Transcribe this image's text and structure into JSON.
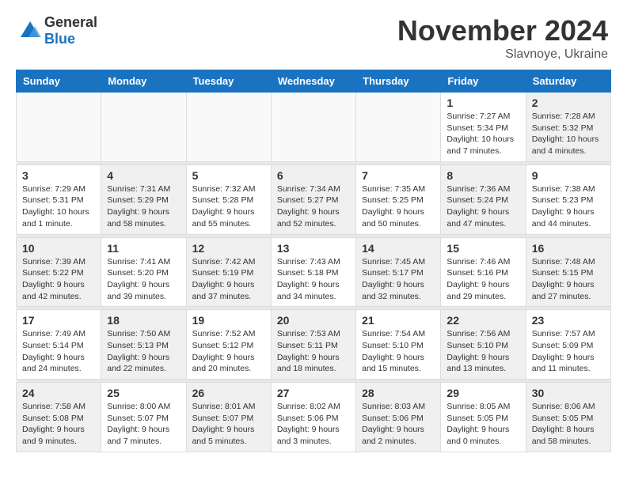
{
  "header": {
    "logo": {
      "general": "General",
      "blue": "Blue"
    },
    "title": "November 2024",
    "location": "Slavnoye, Ukraine"
  },
  "calendar": {
    "days_of_week": [
      "Sunday",
      "Monday",
      "Tuesday",
      "Wednesday",
      "Thursday",
      "Friday",
      "Saturday"
    ],
    "weeks": [
      {
        "days": [
          {
            "num": "",
            "empty": true
          },
          {
            "num": "",
            "empty": true
          },
          {
            "num": "",
            "empty": true
          },
          {
            "num": "",
            "empty": true
          },
          {
            "num": "",
            "empty": true
          },
          {
            "num": "1",
            "sunrise": "Sunrise: 7:27 AM",
            "sunset": "Sunset: 5:34 PM",
            "daylight": "Daylight: 10 hours and 7 minutes."
          },
          {
            "num": "2",
            "sunrise": "Sunrise: 7:28 AM",
            "sunset": "Sunset: 5:32 PM",
            "daylight": "Daylight: 10 hours and 4 minutes.",
            "shaded": true
          }
        ]
      },
      {
        "days": [
          {
            "num": "3",
            "sunrise": "Sunrise: 7:29 AM",
            "sunset": "Sunset: 5:31 PM",
            "daylight": "Daylight: 10 hours and 1 minute."
          },
          {
            "num": "4",
            "sunrise": "Sunrise: 7:31 AM",
            "sunset": "Sunset: 5:29 PM",
            "daylight": "Daylight: 9 hours and 58 minutes.",
            "shaded": true
          },
          {
            "num": "5",
            "sunrise": "Sunrise: 7:32 AM",
            "sunset": "Sunset: 5:28 PM",
            "daylight": "Daylight: 9 hours and 55 minutes."
          },
          {
            "num": "6",
            "sunrise": "Sunrise: 7:34 AM",
            "sunset": "Sunset: 5:27 PM",
            "daylight": "Daylight: 9 hours and 52 minutes.",
            "shaded": true
          },
          {
            "num": "7",
            "sunrise": "Sunrise: 7:35 AM",
            "sunset": "Sunset: 5:25 PM",
            "daylight": "Daylight: 9 hours and 50 minutes."
          },
          {
            "num": "8",
            "sunrise": "Sunrise: 7:36 AM",
            "sunset": "Sunset: 5:24 PM",
            "daylight": "Daylight: 9 hours and 47 minutes.",
            "shaded": true
          },
          {
            "num": "9",
            "sunrise": "Sunrise: 7:38 AM",
            "sunset": "Sunset: 5:23 PM",
            "daylight": "Daylight: 9 hours and 44 minutes."
          }
        ]
      },
      {
        "days": [
          {
            "num": "10",
            "sunrise": "Sunrise: 7:39 AM",
            "sunset": "Sunset: 5:22 PM",
            "daylight": "Daylight: 9 hours and 42 minutes.",
            "shaded": true
          },
          {
            "num": "11",
            "sunrise": "Sunrise: 7:41 AM",
            "sunset": "Sunset: 5:20 PM",
            "daylight": "Daylight: 9 hours and 39 minutes."
          },
          {
            "num": "12",
            "sunrise": "Sunrise: 7:42 AM",
            "sunset": "Sunset: 5:19 PM",
            "daylight": "Daylight: 9 hours and 37 minutes.",
            "shaded": true
          },
          {
            "num": "13",
            "sunrise": "Sunrise: 7:43 AM",
            "sunset": "Sunset: 5:18 PM",
            "daylight": "Daylight: 9 hours and 34 minutes."
          },
          {
            "num": "14",
            "sunrise": "Sunrise: 7:45 AM",
            "sunset": "Sunset: 5:17 PM",
            "daylight": "Daylight: 9 hours and 32 minutes.",
            "shaded": true
          },
          {
            "num": "15",
            "sunrise": "Sunrise: 7:46 AM",
            "sunset": "Sunset: 5:16 PM",
            "daylight": "Daylight: 9 hours and 29 minutes."
          },
          {
            "num": "16",
            "sunrise": "Sunrise: 7:48 AM",
            "sunset": "Sunset: 5:15 PM",
            "daylight": "Daylight: 9 hours and 27 minutes.",
            "shaded": true
          }
        ]
      },
      {
        "days": [
          {
            "num": "17",
            "sunrise": "Sunrise: 7:49 AM",
            "sunset": "Sunset: 5:14 PM",
            "daylight": "Daylight: 9 hours and 24 minutes."
          },
          {
            "num": "18",
            "sunrise": "Sunrise: 7:50 AM",
            "sunset": "Sunset: 5:13 PM",
            "daylight": "Daylight: 9 hours and 22 minutes.",
            "shaded": true
          },
          {
            "num": "19",
            "sunrise": "Sunrise: 7:52 AM",
            "sunset": "Sunset: 5:12 PM",
            "daylight": "Daylight: 9 hours and 20 minutes."
          },
          {
            "num": "20",
            "sunrise": "Sunrise: 7:53 AM",
            "sunset": "Sunset: 5:11 PM",
            "daylight": "Daylight: 9 hours and 18 minutes.",
            "shaded": true
          },
          {
            "num": "21",
            "sunrise": "Sunrise: 7:54 AM",
            "sunset": "Sunset: 5:10 PM",
            "daylight": "Daylight: 9 hours and 15 minutes."
          },
          {
            "num": "22",
            "sunrise": "Sunrise: 7:56 AM",
            "sunset": "Sunset: 5:10 PM",
            "daylight": "Daylight: 9 hours and 13 minutes.",
            "shaded": true
          },
          {
            "num": "23",
            "sunrise": "Sunrise: 7:57 AM",
            "sunset": "Sunset: 5:09 PM",
            "daylight": "Daylight: 9 hours and 11 minutes."
          }
        ]
      },
      {
        "days": [
          {
            "num": "24",
            "sunrise": "Sunrise: 7:58 AM",
            "sunset": "Sunset: 5:08 PM",
            "daylight": "Daylight: 9 hours and 9 minutes.",
            "shaded": true
          },
          {
            "num": "25",
            "sunrise": "Sunrise: 8:00 AM",
            "sunset": "Sunset: 5:07 PM",
            "daylight": "Daylight: 9 hours and 7 minutes."
          },
          {
            "num": "26",
            "sunrise": "Sunrise: 8:01 AM",
            "sunset": "Sunset: 5:07 PM",
            "daylight": "Daylight: 9 hours and 5 minutes.",
            "shaded": true
          },
          {
            "num": "27",
            "sunrise": "Sunrise: 8:02 AM",
            "sunset": "Sunset: 5:06 PM",
            "daylight": "Daylight: 9 hours and 3 minutes."
          },
          {
            "num": "28",
            "sunrise": "Sunrise: 8:03 AM",
            "sunset": "Sunset: 5:06 PM",
            "daylight": "Daylight: 9 hours and 2 minutes.",
            "shaded": true
          },
          {
            "num": "29",
            "sunrise": "Sunrise: 8:05 AM",
            "sunset": "Sunset: 5:05 PM",
            "daylight": "Daylight: 9 hours and 0 minutes."
          },
          {
            "num": "30",
            "sunrise": "Sunrise: 8:06 AM",
            "sunset": "Sunset: 5:05 PM",
            "daylight": "Daylight: 8 hours and 58 minutes.",
            "shaded": true
          }
        ]
      }
    ]
  }
}
